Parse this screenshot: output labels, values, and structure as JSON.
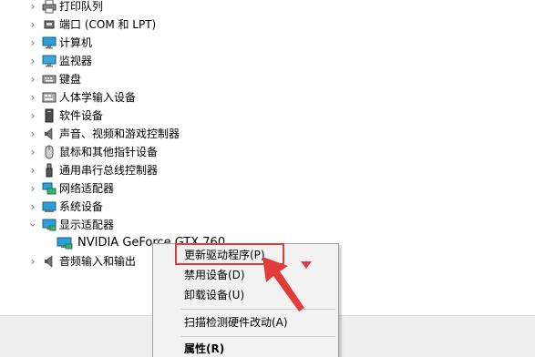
{
  "tree": {
    "items": [
      {
        "label": "打印队列",
        "icon": "printer-icon",
        "expanded": false
      },
      {
        "label": "端口 (COM 和 LPT)",
        "icon": "port-icon",
        "expanded": false
      },
      {
        "label": "计算机",
        "icon": "computer-icon",
        "expanded": false
      },
      {
        "label": "监视器",
        "icon": "monitor-icon",
        "expanded": false
      },
      {
        "label": "键盘",
        "icon": "keyboard-icon",
        "expanded": false
      },
      {
        "label": "人体学输入设备",
        "icon": "hid-icon",
        "expanded": false
      },
      {
        "label": "软件设备",
        "icon": "software-device-icon",
        "expanded": false
      },
      {
        "label": "声音、视频和游戏控制器",
        "icon": "speaker-icon",
        "expanded": false
      },
      {
        "label": "鼠标和其他指针设备",
        "icon": "mouse-icon",
        "expanded": false
      },
      {
        "label": "通用串行总线控制器",
        "icon": "usb-icon",
        "expanded": false
      },
      {
        "label": "网络适配器",
        "icon": "network-adapter-icon",
        "expanded": false
      },
      {
        "label": "系统设备",
        "icon": "system-device-icon",
        "expanded": false
      },
      {
        "label": "显示适配器",
        "icon": "display-adapter-icon",
        "expanded": true
      },
      {
        "label": "音频输入和输出",
        "icon": "audio-io-icon",
        "expanded": false
      }
    ],
    "child": {
      "label": "NVIDIA GeForce GTX 760",
      "icon": "display-adapter-icon"
    }
  },
  "context_menu": {
    "items": [
      {
        "label": "更新驱动程序(P)",
        "highlighted": true
      },
      {
        "label": "禁用设备(D)"
      },
      {
        "label": "卸载设备(U)"
      },
      {
        "label": "扫描检测硬件改动(A)"
      },
      {
        "label": "属性(R)",
        "bold": true
      }
    ]
  },
  "colors": {
    "annotation": "#e23b3b",
    "menu_bg": "#f2f2f2"
  }
}
